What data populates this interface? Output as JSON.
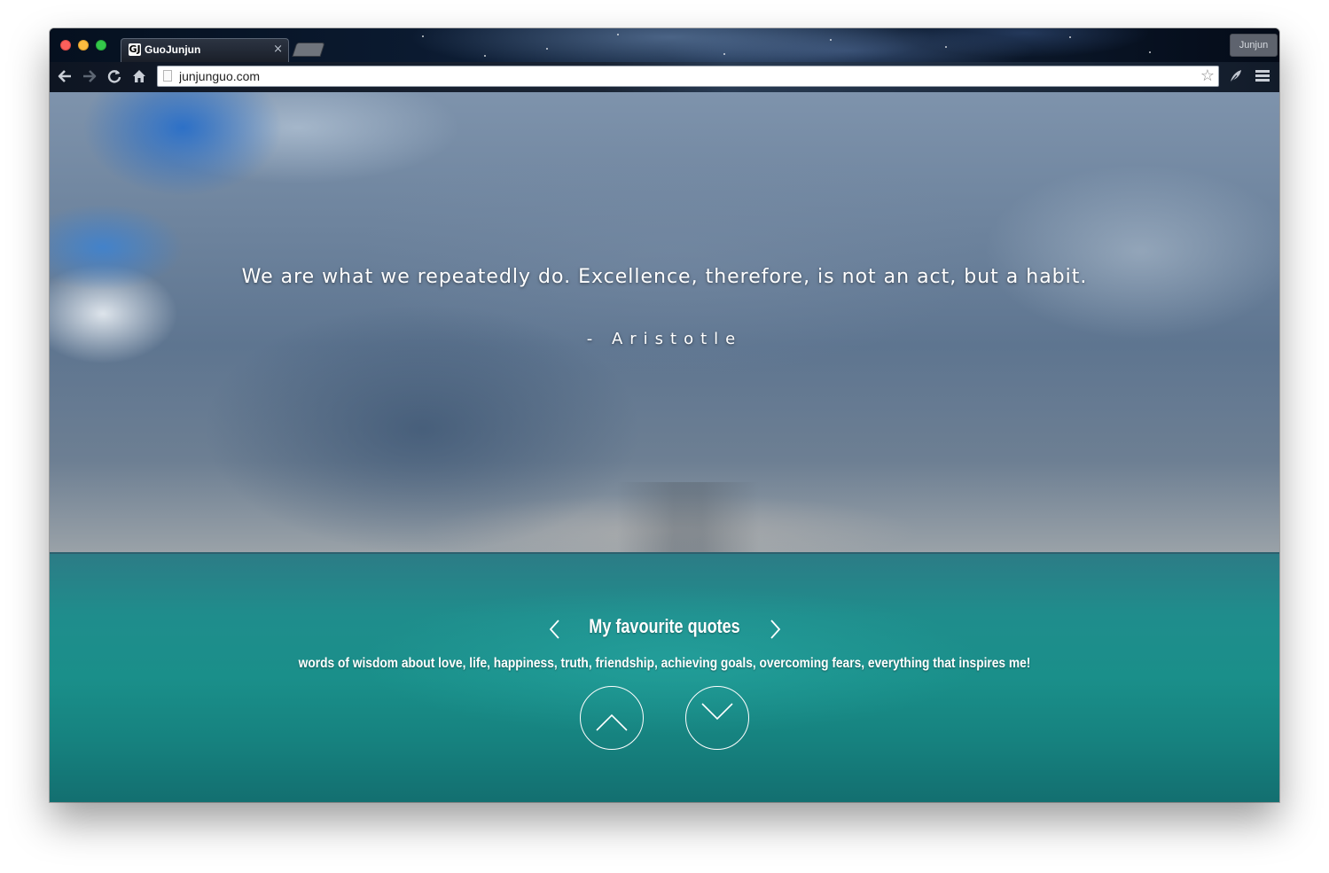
{
  "browser": {
    "tab": {
      "favicon": "GJ",
      "title": "GuoJunjun",
      "close": "×"
    },
    "profile_name": "Junjun",
    "url": "junjunguo.com",
    "icons": {
      "back": "back-arrow-icon",
      "forward": "forward-arrow-icon",
      "reload": "reload-icon",
      "home": "home-icon",
      "bookmark": "star-icon",
      "extension": "feather-icon",
      "menu": "hamburger-menu-icon"
    }
  },
  "page": {
    "quote": "We are what we repeatedly do. Excellence, therefore, is not an act, but a habit.",
    "author": "- Aristotle",
    "section_title": "My favourite quotes",
    "section_subtitle": "words of wisdom about love, life, happiness, truth, friendship, achieving goals, overcoming fears, everything that inspires me!"
  }
}
